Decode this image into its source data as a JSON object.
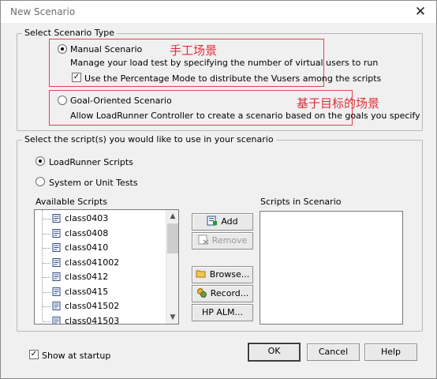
{
  "window": {
    "title": "New Scenario",
    "close_glyph": "✕"
  },
  "scenario_type": {
    "legend": "Select Scenario Type",
    "manual": {
      "label": "Manual Scenario",
      "description": "Manage your load test by specifying the number of virtual users to run",
      "selected": true,
      "percentage_mode_label": "Use the Percentage Mode to distribute the Vusers among the scripts",
      "percentage_mode_checked": true,
      "annotation": "手工场景"
    },
    "goal": {
      "label": "Goal-Oriented Scenario",
      "description": "Allow LoadRunner Controller to create a scenario based on the goals you specify",
      "selected": false,
      "annotation": "基于目标的场景"
    }
  },
  "scripts": {
    "legend": "Select the script(s) you would like to use in your scenario",
    "loadrunner_label": "LoadRunner Scripts",
    "loadrunner_selected": true,
    "system_label": "System or Unit Tests",
    "system_selected": false,
    "available_label": "Available Scripts",
    "in_scenario_label": "Scripts in Scenario",
    "available": [
      "class0403",
      "class0408",
      "class0410",
      "class041002",
      "class0412",
      "class0415",
      "class041502",
      "class041503"
    ],
    "in_scenario": [],
    "buttons": {
      "add": "Add ==>>",
      "remove": "Remove",
      "browse": "Browse...",
      "record": "Record...",
      "hp_alm": "HP ALM..."
    }
  },
  "footer": {
    "show_at_startup_label": "Show at startup",
    "show_at_startup_checked": true,
    "ok": "OK",
    "cancel": "Cancel",
    "help": "Help"
  }
}
